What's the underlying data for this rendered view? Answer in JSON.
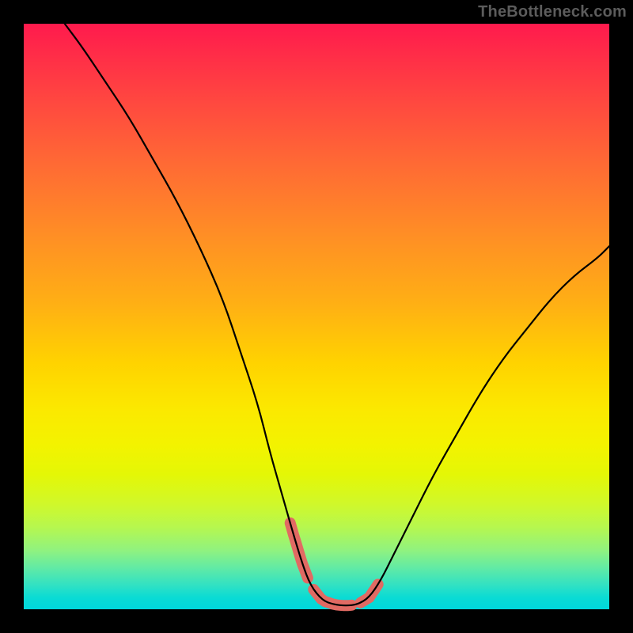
{
  "watermark": "TheBottleneck.com",
  "colors": {
    "frame": "#000000",
    "curve": "#000000",
    "segment": "#e16a63"
  },
  "chart_data": {
    "type": "line",
    "title": "",
    "xlabel": "",
    "ylabel": "",
    "xlim": [
      0,
      100
    ],
    "ylim": [
      0,
      100
    ],
    "grid": false,
    "series": [
      {
        "name": "curve",
        "x": [
          7,
          10,
          14,
          18,
          22,
          26,
          30,
          34,
          37,
          40,
          42,
          44,
          46,
          47.5,
          49,
          51,
          53,
          55,
          57,
          59,
          61,
          63,
          66,
          70,
          74,
          78,
          82,
          86,
          90,
          94,
          98,
          100
        ],
        "y": [
          100,
          96,
          90,
          84,
          77,
          70,
          62,
          53,
          44,
          35,
          27,
          20,
          13,
          8,
          4,
          1.5,
          0.8,
          0.6,
          0.8,
          2,
          5,
          9,
          15,
          23,
          30,
          37,
          43,
          48,
          53,
          57,
          60,
          62
        ]
      }
    ],
    "highlight_segments": [
      {
        "x_range": [
          45.5,
          48.5
        ]
      },
      {
        "x_range": [
          49.5,
          56.0
        ]
      },
      {
        "x_range": [
          57.5,
          60.5
        ]
      }
    ],
    "background_gradient_stops": [
      {
        "pos": 0,
        "color": "#ff1a4d"
      },
      {
        "pos": 24,
        "color": "#ff6a34"
      },
      {
        "pos": 48,
        "color": "#ffb014"
      },
      {
        "pos": 72,
        "color": "#f3f300"
      },
      {
        "pos": 90,
        "color": "#8ff280"
      },
      {
        "pos": 100,
        "color": "#00d8dc"
      }
    ]
  }
}
